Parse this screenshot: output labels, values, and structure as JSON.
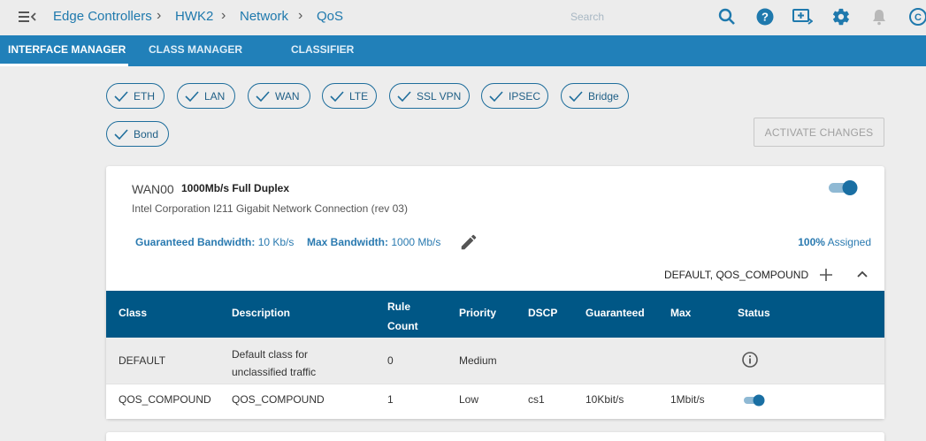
{
  "breadcrumb": [
    "Edge Controllers",
    "HWK2",
    "Network",
    "QoS"
  ],
  "search": {
    "placeholder": "Search",
    "value": ""
  },
  "toolbar_icons": [
    "search-icon",
    "help-icon",
    "screen-add-icon",
    "gear-icon",
    "bell-icon",
    "user-icon"
  ],
  "nav_tabs": [
    {
      "label": "INTERFACE MANAGER",
      "active": true
    },
    {
      "label": "CLASS MANAGER",
      "active": false
    },
    {
      "label": "CLASSIFIER",
      "active": false
    }
  ],
  "filters": [
    {
      "label": "ETH",
      "checked": true
    },
    {
      "label": "LAN",
      "checked": true
    },
    {
      "label": "WAN",
      "checked": true
    },
    {
      "label": "LTE",
      "checked": true
    },
    {
      "label": "SSL VPN",
      "checked": true
    },
    {
      "label": "IPSEC",
      "checked": true
    },
    {
      "label": "Bridge",
      "checked": true
    },
    {
      "label": "Bond",
      "checked": true
    }
  ],
  "activate_button": {
    "label": "ACTIVATE CHANGES",
    "disabled": true
  },
  "interface": {
    "name": "WAN00",
    "speed": "1000Mb/s Full Duplex",
    "description": "Intel Corporation I211 Gigabit Network Connection (rev 03)",
    "enabled": true,
    "guaranteed_label": "Guaranteed Bandwidth:",
    "guaranteed_value": "10 Kb/s",
    "max_label": "Max Bandwidth:",
    "max_value": "1000 Mb/s",
    "assigned_percent": "100%",
    "assigned_label": "Assigned",
    "class_summary": "DEFAULT, QOS_COMPOUND"
  },
  "table": {
    "headers": {
      "class": "Class",
      "description": "Description",
      "rule_count_1": "Rule",
      "rule_count_2": "Count",
      "priority": "Priority",
      "dscp": "DSCP",
      "guaranteed": "Guaranteed",
      "max": "Max",
      "status": "Status"
    },
    "rows": [
      {
        "class": "DEFAULT",
        "description_1": "Default class for",
        "description_2": "unclassified traffic",
        "rule_count": "0",
        "priority": "Medium",
        "dscp": "",
        "guaranteed": "",
        "max": "",
        "status": "info"
      },
      {
        "class": "QOS_COMPOUND",
        "description": "QOS_COMPOUND",
        "rule_count": "1",
        "priority": "Low",
        "dscp": "cs1",
        "guaranteed": "10Kbit/s",
        "max": "1Mbit/s",
        "status": "enabled"
      }
    ]
  },
  "colors": {
    "brand": "#2180b9",
    "table_header": "#005786",
    "link": "#1f79ad",
    "toggle_on": "#1a6fa3"
  }
}
